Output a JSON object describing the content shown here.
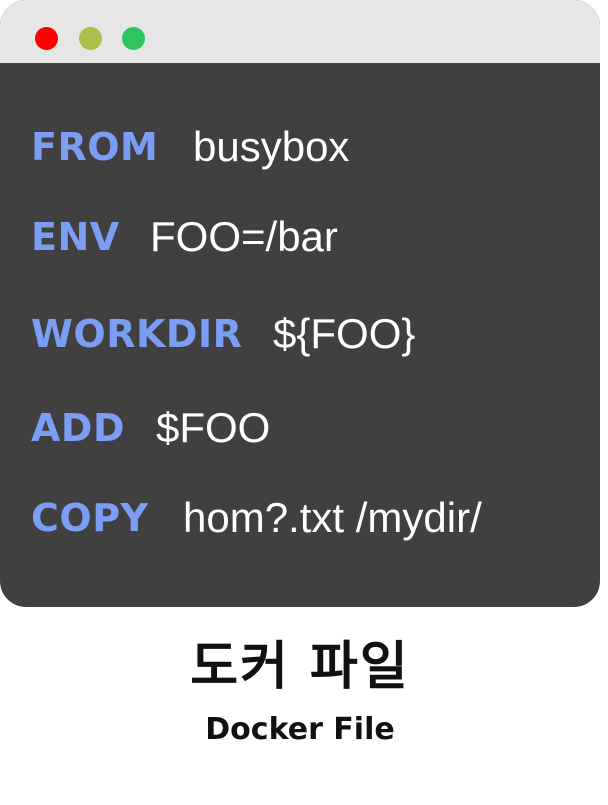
{
  "window": {
    "controls": [
      {
        "name": "close",
        "color": "#ff0000"
      },
      {
        "name": "minimize",
        "color": "#adbf48"
      },
      {
        "name": "maximize",
        "color": "#2fc55e"
      }
    ],
    "colors": {
      "titlebar": "#e6e6e6",
      "editor_background": "#404040",
      "keyword": "#7b9ef5",
      "argument": "#ffffff"
    }
  },
  "code": {
    "lines": [
      {
        "keyword": "FROM",
        "argument": "busybox"
      },
      {
        "keyword": "ENV",
        "argument": "FOO=/bar"
      },
      {
        "keyword": "WORKDIR",
        "argument": "${FOO}"
      },
      {
        "keyword": "ADD",
        "argument": "$FOO"
      },
      {
        "keyword": "COPY",
        "argument": "hom?.txt /mydir/"
      }
    ]
  },
  "caption": {
    "title_ko": "도커 파일",
    "title_en": "Docker File"
  }
}
